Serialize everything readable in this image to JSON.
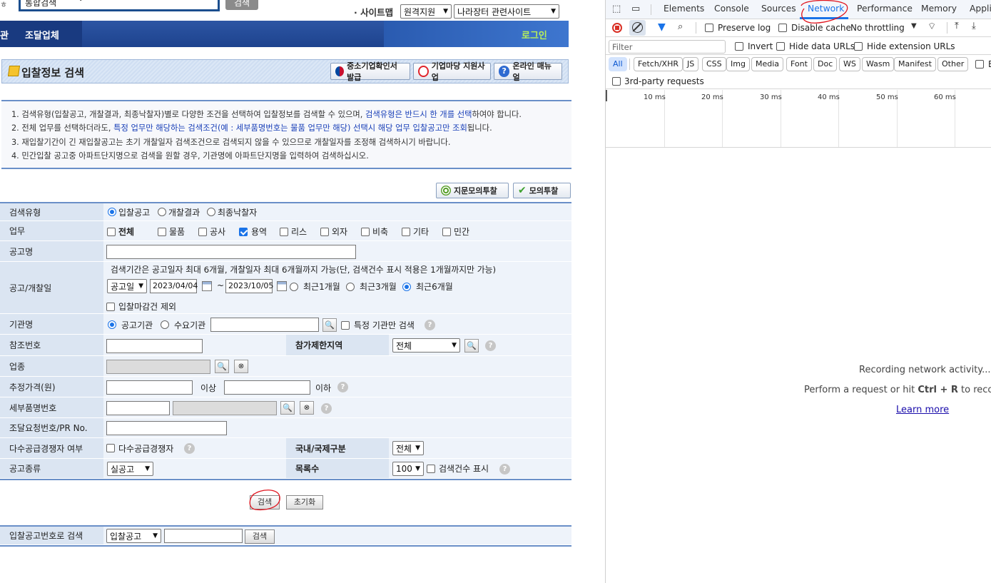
{
  "top": {
    "search_select": "통합검색",
    "search_button": "검색",
    "sitemap_label": "· 사이트맵",
    "site_select_1": "원격지원",
    "site_select_2": "나라장터 관련사이트"
  },
  "nav": {
    "item_partial": "관",
    "item_procurement_company": "조달업체",
    "login": "로그인"
  },
  "title": {
    "page_title": "입찰정보 검색",
    "btn_sme_cert": "중소기업확인서 발급",
    "btn_market": "기업마당 지원사업",
    "btn_manual": "온라인 매뉴얼"
  },
  "notice": {
    "line1_a": "1. 검색유형(입찰공고, 개찰결과, 최종낙찰자)별로 다양한 조건을 선택하여 입찰정보를 검색할 수 있으며, ",
    "line1_b": "검색유형은 반드시 한 개를 선택",
    "line1_c": "하여야 합니다.",
    "line2_a": "2. 전체 업무를 선택하더라도, ",
    "line2_b": "특정 업무만 해당하는 검색조건(예 : 세부품명번호는 물품 업무만 해당) 선택시 해당 업무 입찰공고만 조회",
    "line2_c": "됩니다.",
    "line3": "3. 재입찰기간이 긴 재입찰공고는 초기 개찰일자 검색조건으로 검색되지 않을 수 있으므로 개찰일자를 조정해 검색하시기 바랍니다.",
    "line4": "4. 민간입찰 공고중 아파트단지명으로 검색을 원할 경우, 기관명에 아파트단지명을 입력하여 검색하십시오."
  },
  "sim_buttons": {
    "fingerprint": "지문모의투찰",
    "sim": "모의투찰"
  },
  "form": {
    "search_type_label": "검색유형",
    "search_type_options": [
      "입찰공고",
      "개찰결과",
      "최종낙찰자"
    ],
    "business_label": "업무",
    "business_options": [
      "전체",
      "물품",
      "공사",
      "용역",
      "리스",
      "외자",
      "비축",
      "기타",
      "민간"
    ],
    "notice_name_label": "공고명",
    "period_label": "공고/개찰일",
    "period_note": "검색기간은 공고일자 최대 6개월, 개찰일자 최대 6개월까지 가능(단, 검색건수 표시 적용은 1개월까지만 가능)",
    "period_type": "공고일",
    "date_from": "2023/04/04",
    "date_sep": "~",
    "date_to": "2023/10/05",
    "period_options": [
      "최근1개월",
      "최근3개월",
      "최근6개월"
    ],
    "exclude_closed": "입찰마감건 제외",
    "agency_label": "기관명",
    "agency_options": [
      "공고기관",
      "수요기관"
    ],
    "agency_only": "특정 기관만 검색",
    "ref_label": "참조번호",
    "region_label": "참가제한지역",
    "region_value": "전체",
    "industry_label": "업종",
    "price_label": "추정가격(원)",
    "price_above": "이상",
    "price_below": "이하",
    "item_label": "세부품명번호",
    "pr_label": "조달요청번호/PR No.",
    "multi_label": "다수공급경쟁자 여부",
    "multi_option": "다수공급경쟁자",
    "intl_label": "국내/국제구분",
    "intl_value": "전체",
    "kind_label": "공고종류",
    "kind_value": "실공고",
    "rows_label": "목록수",
    "rows_value": "100",
    "show_count": "검색건수 표시",
    "search_btn": "검색",
    "reset_btn": "초기화",
    "by_number_label": "입찰공고번호로 검색",
    "by_number_select": "입찰공고",
    "by_number_btn": "검색"
  },
  "devtools": {
    "tabs": [
      "Elements",
      "Console",
      "Sources",
      "Network",
      "Performance",
      "Memory",
      "Applic"
    ],
    "active_tab": "Network",
    "preserve_log": "Preserve log",
    "disable_cache": "Disable cache",
    "throttling": "No throttling",
    "filter_placeholder": "Filter",
    "invert": "Invert",
    "hide_data_urls": "Hide data URLs",
    "hide_ext_urls": "Hide extension URLs",
    "type_filters": [
      "All",
      "Fetch/XHR",
      "JS",
      "CSS",
      "Img",
      "Media",
      "Font",
      "Doc",
      "WS",
      "Wasm",
      "Manifest",
      "Other"
    ],
    "type_filter_trailing": "B",
    "third_party": "3rd-party requests",
    "ticks": [
      "10 ms",
      "20 ms",
      "30 ms",
      "40 ms",
      "50 ms",
      "60 ms"
    ],
    "recording": "Recording network activity...",
    "hint_a": "Perform a request or hit ",
    "hint_keys": "Ctrl + R",
    "hint_b": " to record",
    "learn_more": "Learn more",
    "accent": "#1a73e8"
  }
}
